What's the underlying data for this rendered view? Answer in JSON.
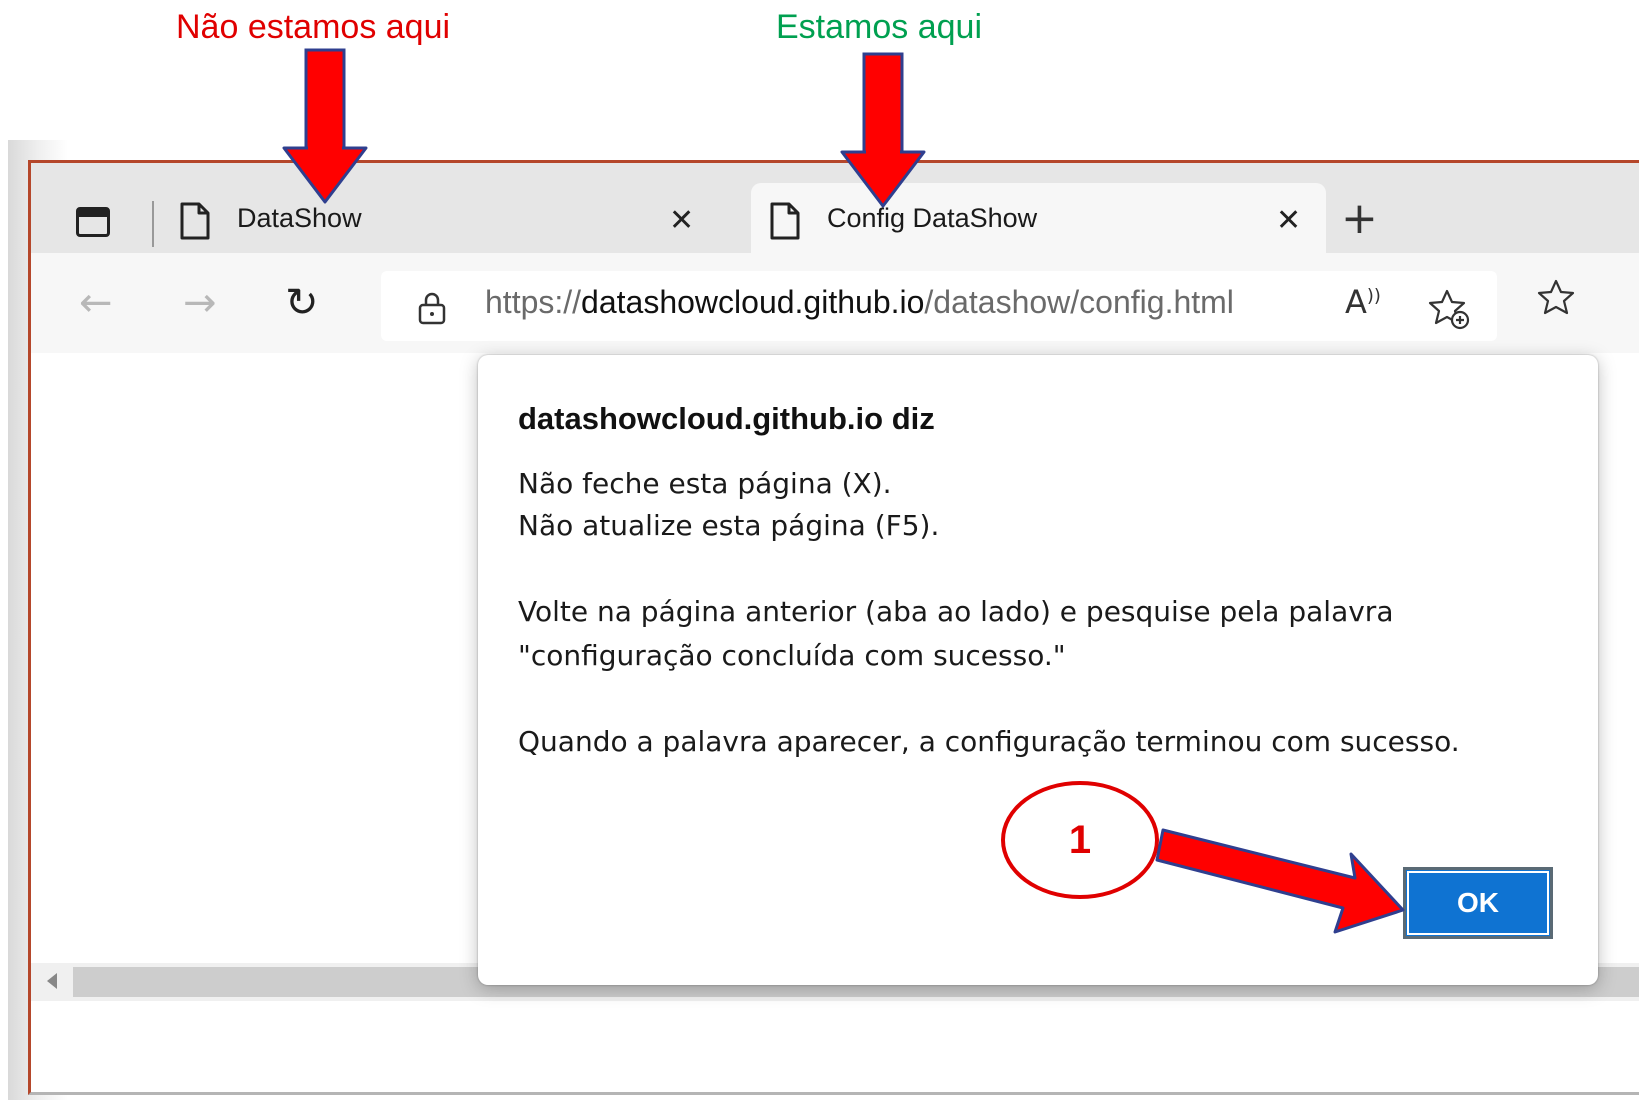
{
  "annotations": {
    "not_here": "Não estamos aqui",
    "we_are_here": "Estamos aqui",
    "step_number": "1",
    "colors": {
      "red": "#e00000",
      "green": "#00a050",
      "arrow_fill": "#ff0000"
    }
  },
  "browser": {
    "tabs": [
      {
        "title": "DataShow",
        "active": false
      },
      {
        "title": "Config DataShow",
        "active": true
      }
    ],
    "toolbar": {
      "url_scheme": "https://",
      "url_host": "datashowcloud.github.io",
      "url_path": "/datashow/config.html",
      "read_aloud_glyph": "Ȃ"
    },
    "icons": [
      "sidebar-icon",
      "page-icon",
      "close-icon",
      "plus-icon",
      "back-arrow-icon",
      "forward-arrow-icon",
      "reload-icon",
      "lock-icon",
      "read-aloud-icon",
      "add-favorite-icon",
      "favorites-icon"
    ]
  },
  "dialog": {
    "heading": "datashowcloud.github.io diz",
    "lines": [
      "Não feche esta página (X).",
      "Não atualize esta página (F5).",
      "Volte na página anterior (aba ao lado) e pesquise pela palavra",
      "\"configuração concluída com sucesso.\"",
      "Quando a palavra aparecer, a configuração terminou com sucesso."
    ],
    "ok_label": "OK",
    "accent": "#0f73d2"
  }
}
